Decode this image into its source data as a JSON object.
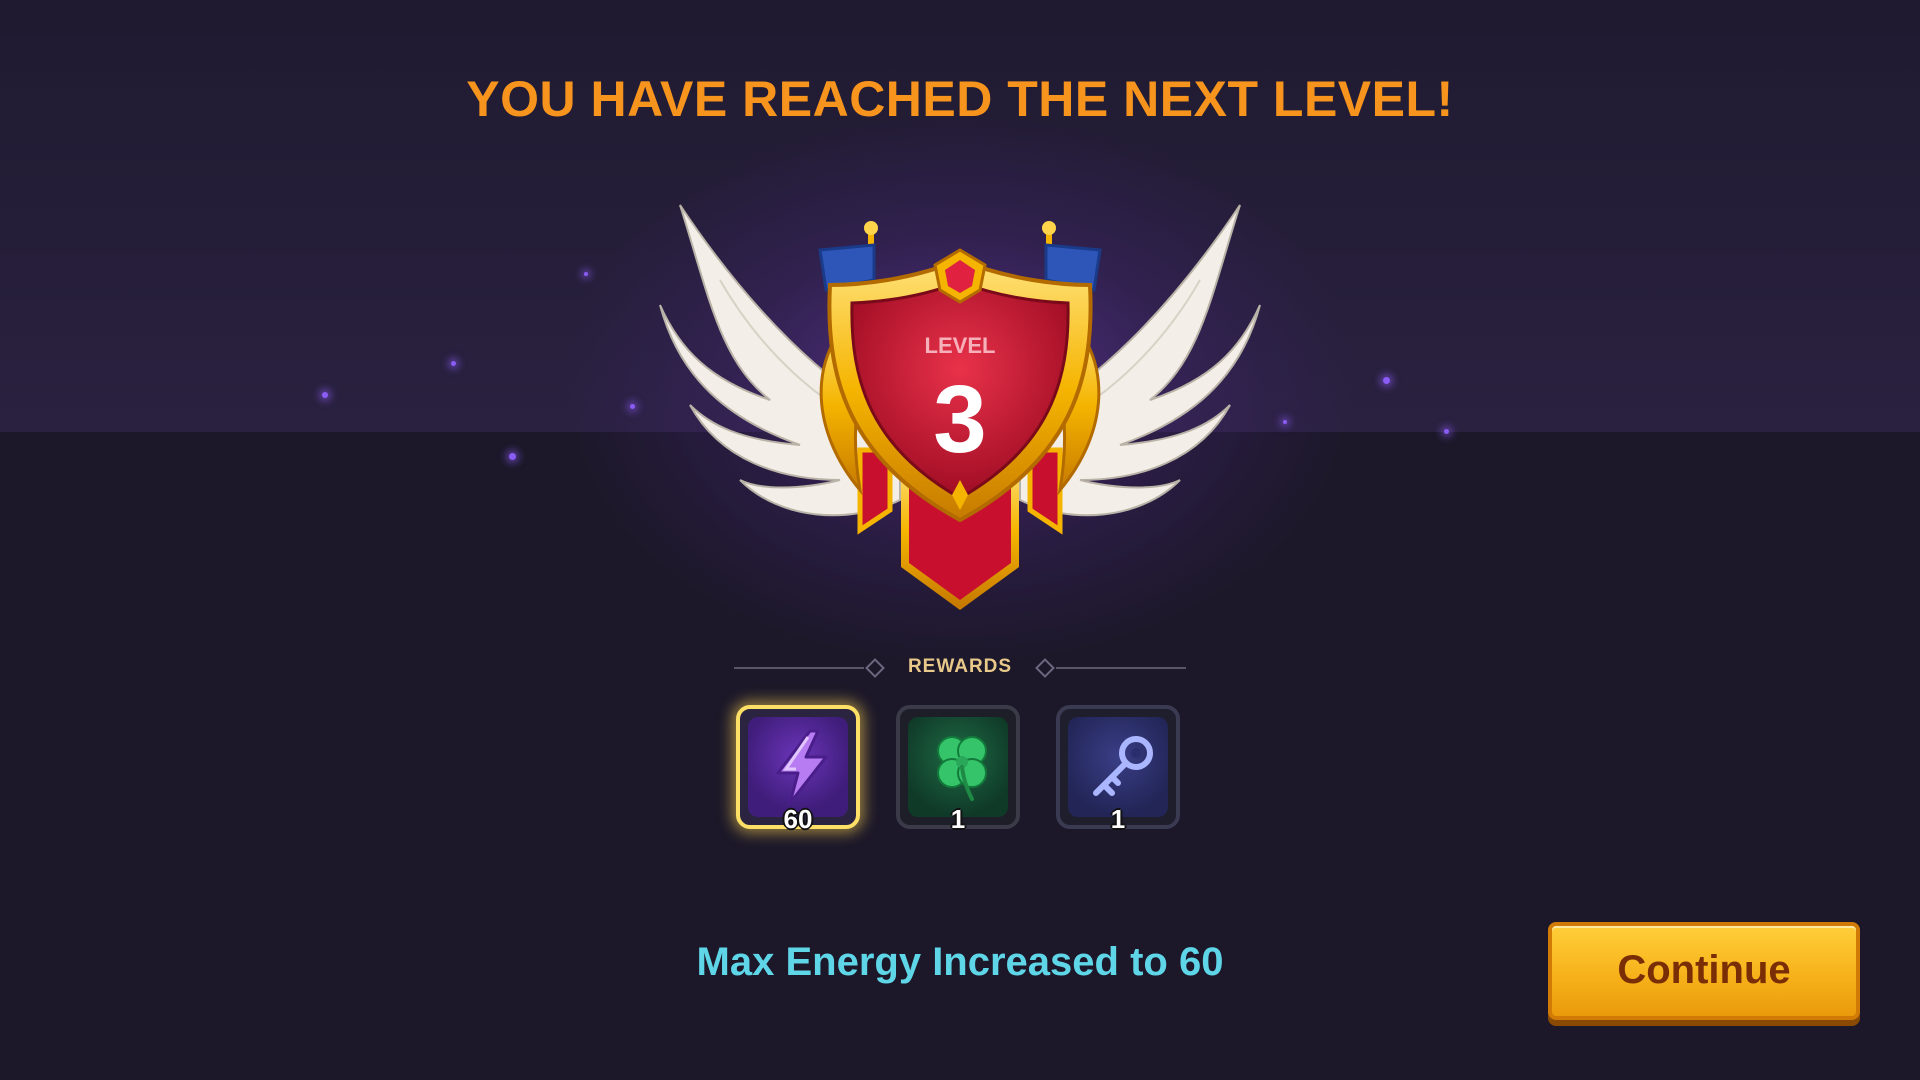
{
  "title": "YOU HAVE REACHED THE NEXT LEVEL!",
  "badge": {
    "level_label": "LEVEL",
    "level_number": "3"
  },
  "rewards": {
    "label": "REWARDS",
    "items": [
      {
        "icon": "lightning-icon",
        "quantity": "60",
        "selected": true
      },
      {
        "icon": "four-leaf-clover-icon",
        "quantity": "1",
        "selected": false
      },
      {
        "icon": "key-icon",
        "quantity": "1",
        "selected": false
      }
    ]
  },
  "info_text": "Max Energy Increased to 60",
  "continue_label": "Continue",
  "colors": {
    "title": "#f7941d",
    "info": "#5fd6e8",
    "button": "#f7b21a",
    "badge_red": "#c8102e",
    "badge_gold": "#f5b400"
  }
}
